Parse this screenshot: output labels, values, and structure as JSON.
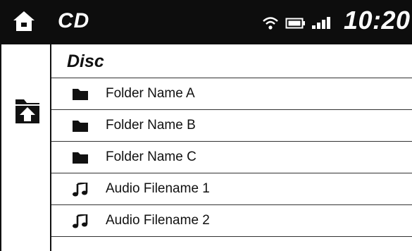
{
  "header": {
    "title": "CD",
    "clock": "10:20",
    "status_icons": [
      "wifi-icon",
      "battery-icon",
      "signal-icon"
    ],
    "home_icon": "home-icon"
  },
  "navigation": {
    "up_icon": "folder-up-icon"
  },
  "list": {
    "header_label": "Disc",
    "items": [
      {
        "label": "Folder Name A",
        "icon": "folder-icon"
      },
      {
        "label": "Folder Name B",
        "icon": "folder-icon"
      },
      {
        "label": "Folder Name C",
        "icon": "folder-icon"
      },
      {
        "label": "Audio Filename 1",
        "icon": "music-note-icon"
      },
      {
        "label": "Audio Filename 2",
        "icon": "music-note-icon"
      }
    ]
  },
  "colors": {
    "header_bg": "#0d0d0d",
    "background": "#ffffff",
    "text": "#111111"
  }
}
